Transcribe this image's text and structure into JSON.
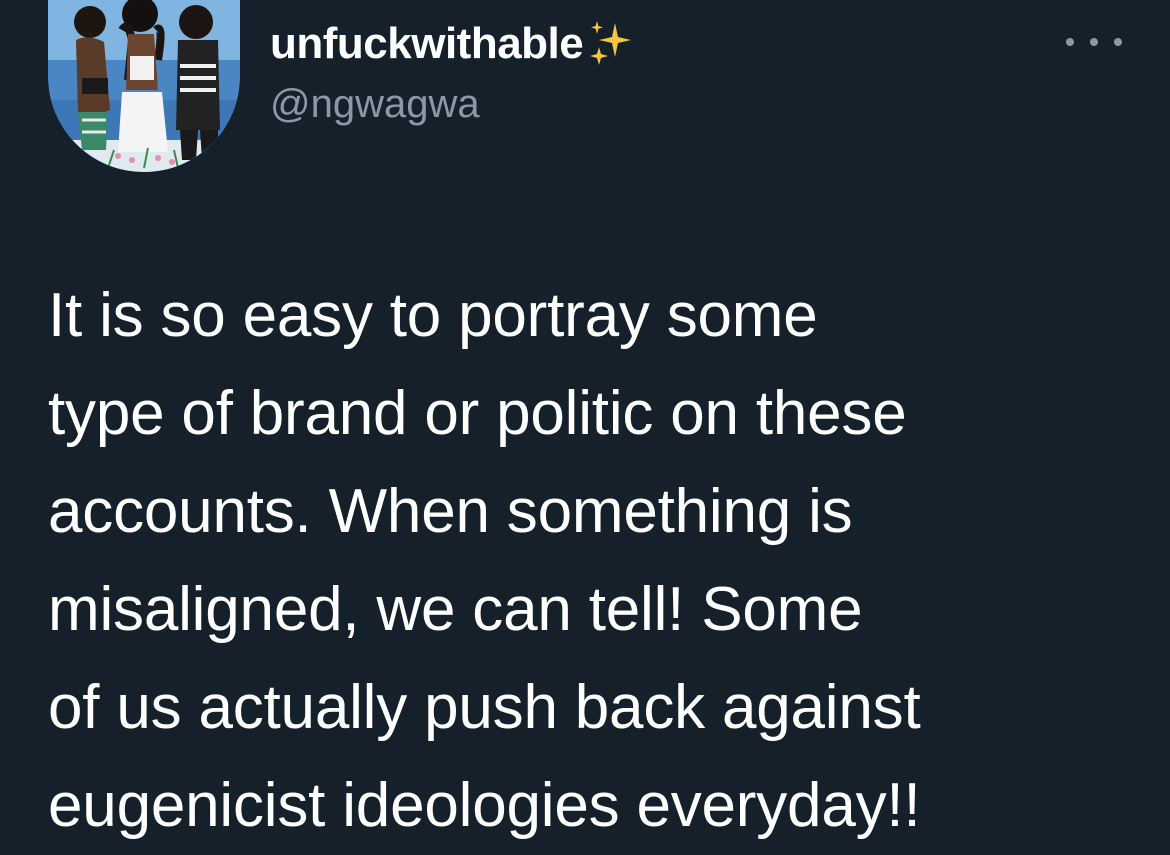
{
  "author": {
    "display_name": "unfuckwithable",
    "badge_icon": "sparkles-icon",
    "handle": "@ngwagwa",
    "avatar_icon": "avatar-illustration"
  },
  "actions": {
    "more_icon": "more-options-icon"
  },
  "tweet": {
    "text": "It is so easy to portray some\ntype of brand or politic on these\naccounts. When something is\nmisaligned, we can tell! Some\nof us actually push back against\neugenicist ideologies everyday!!"
  },
  "colors": {
    "background": "#15202b",
    "text_primary": "#ffffff",
    "text_secondary": "#8b98a5",
    "sparkle": "#f5c542"
  }
}
